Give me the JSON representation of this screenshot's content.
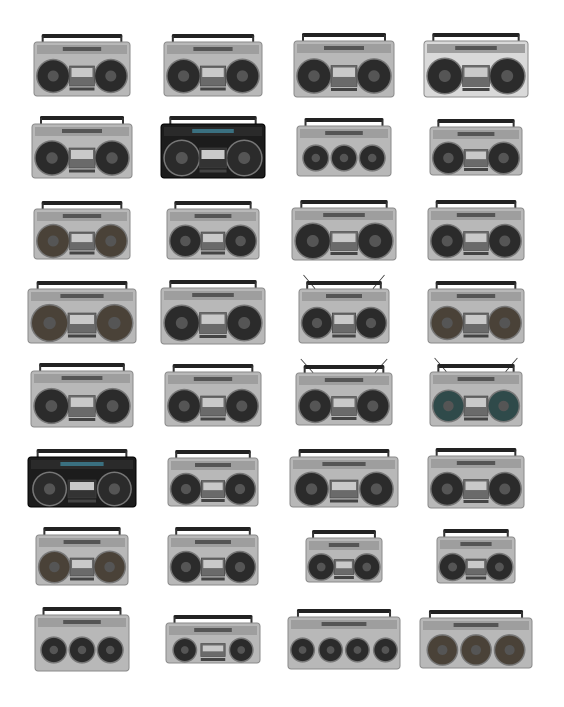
{
  "image": {
    "background": "#ffffff",
    "subject": "boombox",
    "rows": 8,
    "columns": 4,
    "item_count": 32,
    "palette": {
      "silver_light": "#d9d9d9",
      "silver": "#b8b8b8",
      "silver_dark": "#8a8a8a",
      "black": "#1c1c1c",
      "speaker_dark": "#2b2b2b",
      "speaker_brown": "#4a4238",
      "speaker_teal": "#2f4a4a",
      "red_accent": "#9b2a22"
    }
  }
}
